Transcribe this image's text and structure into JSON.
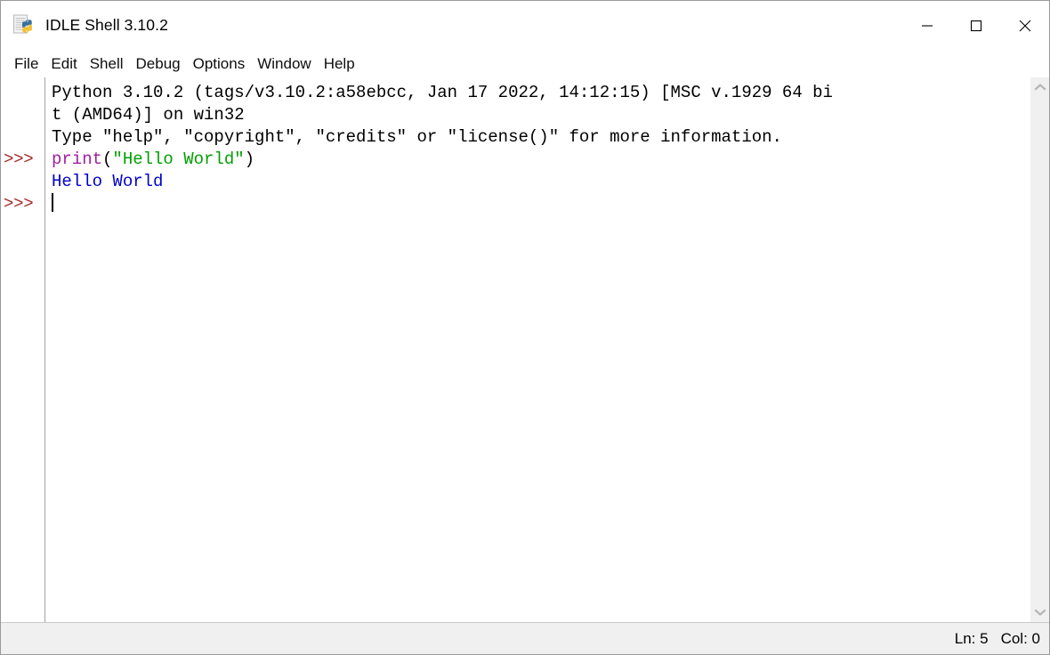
{
  "window": {
    "title": "IDLE Shell 3.10.2",
    "icon": "python-document-icon",
    "controls": {
      "minimize": "minimize-icon",
      "maximize": "maximize-icon",
      "close": "close-icon"
    }
  },
  "menubar": {
    "items": [
      {
        "label": "File"
      },
      {
        "label": "Edit"
      },
      {
        "label": "Shell"
      },
      {
        "label": "Debug"
      },
      {
        "label": "Options"
      },
      {
        "label": "Window"
      },
      {
        "label": "Help"
      }
    ]
  },
  "shell": {
    "prompt": ">>>",
    "gutter": [
      "",
      "",
      "",
      ">>>",
      "",
      ">>>"
    ],
    "lines": [
      {
        "kind": "banner",
        "spans": [
          {
            "text": "Python 3.10.2 (tags/v3.10.2:a58ebcc, Jan 17 2022, 14:12:15) [MSC v.1929 64 bi",
            "color": "black"
          }
        ]
      },
      {
        "kind": "banner",
        "spans": [
          {
            "text": "t (AMD64)] on win32",
            "color": "black"
          }
        ]
      },
      {
        "kind": "banner",
        "spans": [
          {
            "text": "Type \"help\", \"copyright\", \"credits\" or \"license()\" for more information.",
            "color": "black"
          }
        ]
      },
      {
        "kind": "input",
        "spans": [
          {
            "text": "print",
            "color": "builtin"
          },
          {
            "text": "(",
            "color": "black"
          },
          {
            "text": "\"Hello World\"",
            "color": "string"
          },
          {
            "text": ")",
            "color": "black"
          }
        ]
      },
      {
        "kind": "output",
        "spans": [
          {
            "text": "Hello World",
            "color": "output"
          }
        ]
      },
      {
        "kind": "input",
        "spans": [
          {
            "text": "",
            "color": "black"
          }
        ],
        "caret": true
      }
    ]
  },
  "scrollbar": {
    "up_arrow": "chevron-up-icon",
    "down_arrow": "chevron-down-icon"
  },
  "statusbar": {
    "line_label": "Ln: 5",
    "col_label": "Col: 0"
  },
  "colors": {
    "prompt": "#a52a2a",
    "builtin": "#a020a0",
    "string": "#00a000",
    "output": "#0000cc",
    "text": "#000000",
    "chrome": "#f0f0f0"
  }
}
